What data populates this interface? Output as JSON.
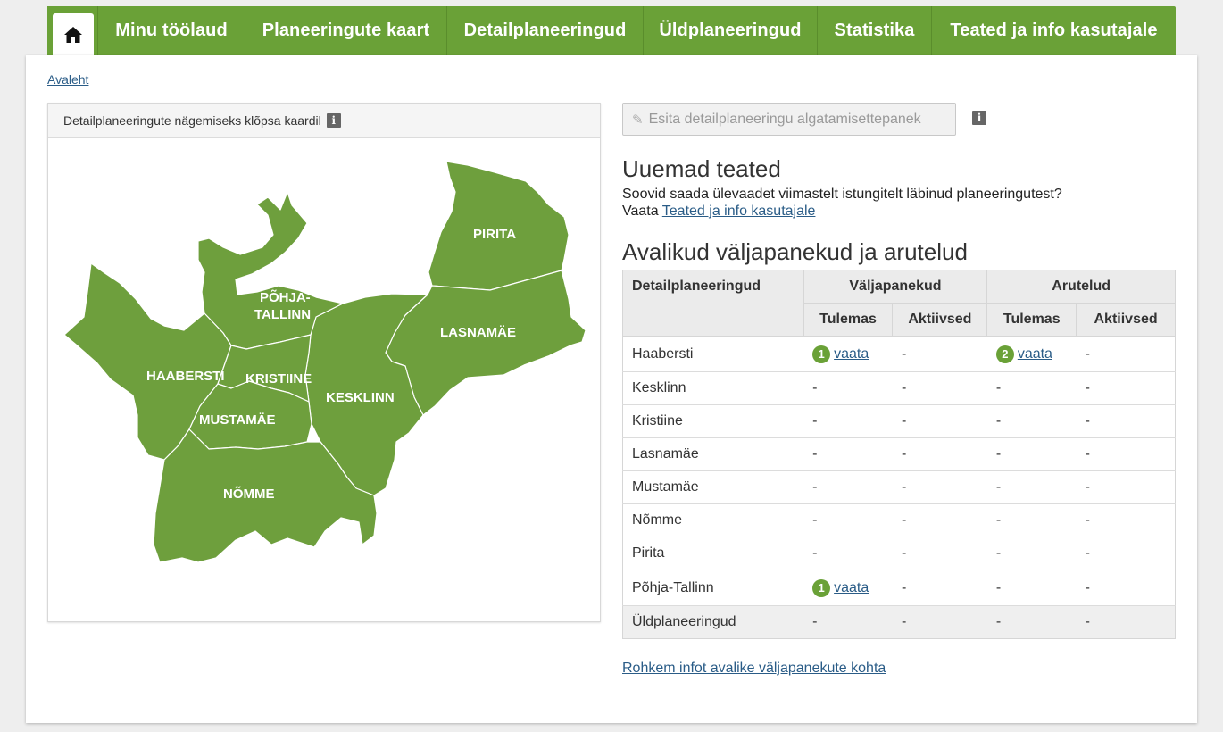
{
  "nav": {
    "home_icon": "home-icon",
    "tabs": [
      "Minu töölaud",
      "Planeeringute kaart",
      "Detailplaneeringud",
      "Üldplaneeringud",
      "Statistika",
      "Teated ja info kasutajale"
    ]
  },
  "breadcrumb": "Avaleht",
  "map": {
    "header": "Detailplaneeringute nägemiseks klõpsa kaardil",
    "districts": [
      "PIRITA",
      "PÕHJA-",
      "TALLINN",
      "LASNAMÄE",
      "HAABERSTI",
      "KRISTIINE",
      "KESKLINN",
      "MUSTAMÄE",
      "NÕMME"
    ],
    "fill_color": "#6e9f3d"
  },
  "propose_button": "Esita detailplaneeringu algatamisettepanek",
  "news": {
    "title": "Uuemad teated",
    "line1": "Soovid saada ülevaadet viimastelt istungitelt läbinud planeeringutest?",
    "line2_prefix": "Vaata",
    "line2_link": "Teated ja info kasutajale"
  },
  "public": {
    "title": "Avalikud väljapanekud ja arutelud",
    "headers": {
      "col1": "Detailplaneeringud",
      "group1": "Väljapanekud",
      "group2": "Arutelud",
      "sub1": "Tulemas",
      "sub2": "Aktiivsed",
      "sub3": "Tulemas",
      "sub4": "Aktiivsed"
    },
    "rows": [
      {
        "name": "Haabersti",
        "c1_badge": "1",
        "c1_link": "vaata",
        "c2": "-",
        "c3_badge": "2",
        "c3_link": "vaata",
        "c4": "-"
      },
      {
        "name": "Kesklinn",
        "c1": "-",
        "c2": "-",
        "c3": "-",
        "c4": "-"
      },
      {
        "name": "Kristiine",
        "c1": "-",
        "c2": "-",
        "c3": "-",
        "c4": "-"
      },
      {
        "name": "Lasnamäe",
        "c1": "-",
        "c2": "-",
        "c3": "-",
        "c4": "-"
      },
      {
        "name": "Mustamäe",
        "c1": "-",
        "c2": "-",
        "c3": "-",
        "c4": "-"
      },
      {
        "name": "Nõmme",
        "c1": "-",
        "c2": "-",
        "c3": "-",
        "c4": "-"
      },
      {
        "name": "Pirita",
        "c1": "-",
        "c2": "-",
        "c3": "-",
        "c4": "-"
      },
      {
        "name": "Põhja-Tallinn",
        "c1_badge": "1",
        "c1_link": "vaata",
        "c2": "-",
        "c3": "-",
        "c4": "-"
      },
      {
        "name": "Üldplaneeringud",
        "c1": "-",
        "c2": "-",
        "c3": "-",
        "c4": "-"
      }
    ],
    "more_link": "Rohkem infot avalike väljapanekute kohta"
  },
  "colors": {
    "accent": "#6aa137",
    "link": "#2a5c87"
  }
}
